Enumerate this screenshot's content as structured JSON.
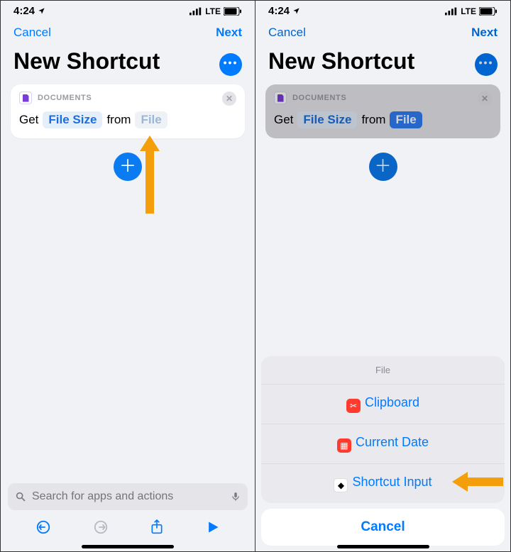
{
  "status": {
    "time": "4:24",
    "carrier": "LTE"
  },
  "nav": {
    "cancel": "Cancel",
    "next": "Next"
  },
  "title": "New Shortcut",
  "card": {
    "category": "DOCUMENTS",
    "get": "Get",
    "attr": "File Size",
    "from": "from",
    "source": "File"
  },
  "search": {
    "placeholder": "Search for apps and actions"
  },
  "sheet": {
    "title": "File",
    "items": [
      {
        "label": "Clipboard",
        "icon_bg": "#ff3b30",
        "glyph": "✂"
      },
      {
        "label": "Current Date",
        "icon_bg": "#ff3b30",
        "glyph": "▦"
      },
      {
        "label": "Shortcut Input",
        "icon_bg": "#ffffff",
        "glyph": "◆",
        "glyph_color": "#000"
      }
    ],
    "cancel": "Cancel"
  }
}
